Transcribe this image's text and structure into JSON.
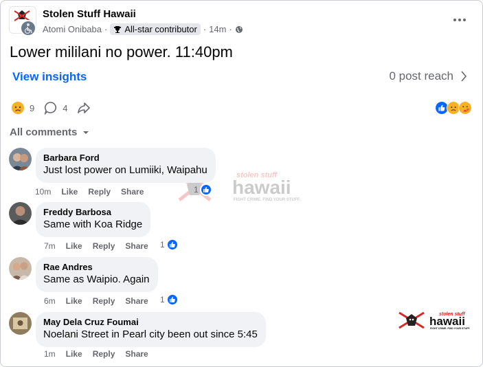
{
  "post": {
    "group_name": "Stolen Stuff Hawaii",
    "author": "Atomi Onibaba",
    "badge": "All-star contributor",
    "time": "14m",
    "text": "Lower mililani no power. 11:40pm"
  },
  "insights": {
    "label": "View insights",
    "reach": "0 post reach"
  },
  "stats": {
    "reactions": "9",
    "comments": "4"
  },
  "comments_filter": "All comments",
  "logo_text": {
    "top": "stolen stuff",
    "main": "hawaii",
    "tag": "FIGHT CRIME. FIND YOUR STUFF."
  },
  "comments": [
    {
      "name": "Barbara Ford",
      "text": "Just lost power on Lumiiki, Waipahu",
      "time": "10m",
      "like": "Like",
      "reply": "Reply",
      "share": "Share",
      "likes": "1"
    },
    {
      "name": "Freddy Barbosa",
      "text": "Same with Koa Ridge",
      "time": "7m",
      "like": "Like",
      "reply": "Reply",
      "share": "Share",
      "likes": "1"
    },
    {
      "name": "Rae Andres",
      "text": "Same as Waipio. Again",
      "time": "6m",
      "like": "Like",
      "reply": "Reply",
      "share": "Share",
      "likes": "1"
    },
    {
      "name": "May Dela Cruz Foumai",
      "text": "Noelani Street in Pearl city been out since 5:45",
      "time": "1m",
      "like": "Like",
      "reply": "Reply",
      "share": "Share",
      "likes": ""
    }
  ],
  "colors": {
    "accent": "#0866ff",
    "muted": "#65676b",
    "bubble": "#f0f2f5",
    "logo_red": "#d62828"
  }
}
